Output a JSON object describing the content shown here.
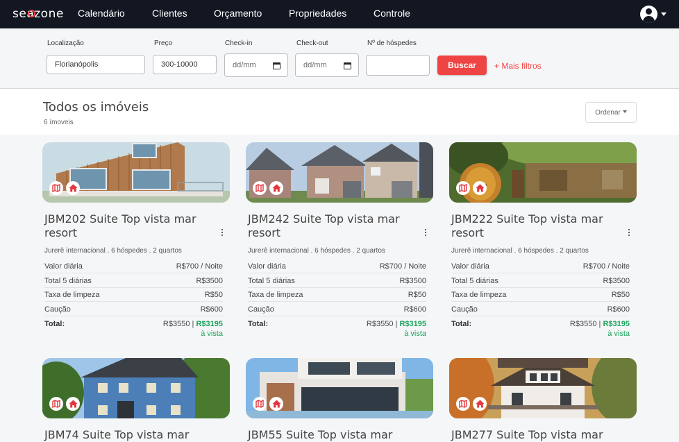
{
  "app": {
    "logo": "seazone",
    "nav": [
      "Calendário",
      "Clientes",
      "Orçamento",
      "Propriedades",
      "Controle"
    ]
  },
  "filters": {
    "location": {
      "label": "Localização",
      "value": "Florianópolis"
    },
    "price": {
      "label": "Preço",
      "value": "300-10000"
    },
    "checkin": {
      "label": "Check-in",
      "value": "dd/mm"
    },
    "checkout": {
      "label": "Check-out",
      "value": "dd/mm"
    },
    "guests": {
      "label": "Nº de hóspedes",
      "value": ""
    },
    "search_label": "Buscar",
    "more_filters": "+ Mais filtros"
  },
  "listing": {
    "title": "Todos os imóveis",
    "count": "6 ímoveis",
    "sort_label": "Ordenar"
  },
  "row_labels": {
    "daily": "Valor diária",
    "total5": "Total 5 diárias",
    "cleaning": "Taxa de limpeza",
    "deposit": "Caução",
    "total": "Total:",
    "cash": "à vista"
  },
  "cards": [
    {
      "title": "JBM202 Suite Top vista mar resort",
      "subtitle": "Jurerê internacional . 6 hóspedes . 2 quartos",
      "daily": "R$700 / Noite",
      "total5": "R$3500",
      "cleaning": "R$50",
      "deposit": "R$600",
      "total": "R$3550",
      "total_cash": "R$3195"
    },
    {
      "title": "JBM242 Suite Top vista mar resort",
      "subtitle": "Jurerê internacional . 6 hóspedes . 2 quartos",
      "daily": "R$700 / Noite",
      "total5": "R$3500",
      "cleaning": "R$50",
      "deposit": "R$600",
      "total": "R$3550",
      "total_cash": "R$3195"
    },
    {
      "title": "JBM222 Suite Top vista mar resort",
      "subtitle": "Jurerê internacional . 6 hóspedes . 2 quartos",
      "daily": "R$700 / Noite",
      "total5": "R$3500",
      "cleaning": "R$50",
      "deposit": "R$600",
      "total": "R$3550",
      "total_cash": "R$3195"
    },
    {
      "title": "JBM74 Suite Top vista mar"
    },
    {
      "title": "JBM55 Suite Top vista mar"
    },
    {
      "title": "JBM277 Suite Top vista mar"
    }
  ],
  "colors": {
    "accent": "#ef4444",
    "green": "#1aa45a",
    "nav_bg": "#131722"
  }
}
